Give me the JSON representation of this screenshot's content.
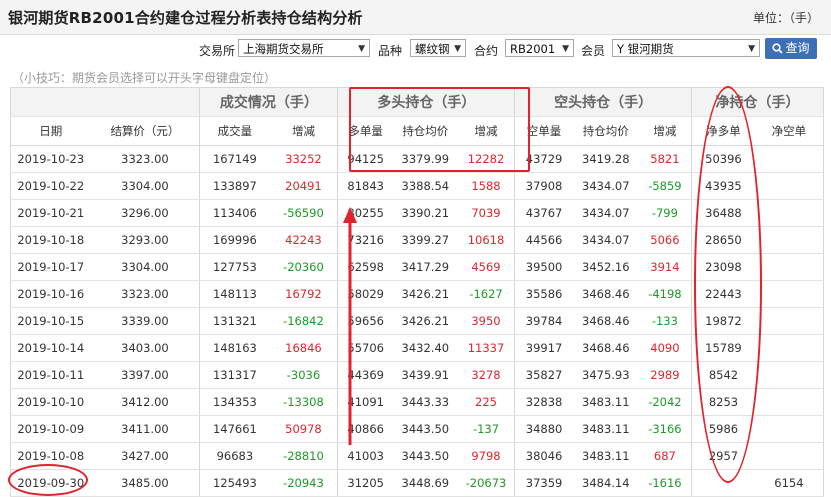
{
  "header": {
    "title": "银河期货RB2001合约建仓过程分析表持仓结构分析",
    "unit": "单位：（手）"
  },
  "filters": {
    "exchange_label": "交易所",
    "exchange_value": "上海期货交易所",
    "variety_label": "品种",
    "variety_value": "螺纹钢",
    "contract_label": "合约",
    "contract_value": "RB2001",
    "member_label": "会员",
    "member_value": "Y 银河期货",
    "search_label": "查询"
  },
  "tip": "（小技巧：期货会员选择可以开头字母键盘定位）",
  "table": {
    "group_headers": [
      "成交情况（手）",
      "多头持仓（手）",
      "空头持仓（手）",
      "净持仓（手）"
    ],
    "columns": [
      "日期",
      "结算价（元）",
      "成交量",
      "增减",
      "多单量",
      "持仓均价",
      "增减",
      "空单量",
      "持仓均价",
      "增减",
      "净多单",
      "净空单"
    ],
    "rows": [
      [
        "2019-10-23",
        "3323.00",
        "167149",
        "33252",
        "94125",
        "3379.99",
        "12282",
        "43729",
        "3419.28",
        "5821",
        "50396",
        ""
      ],
      [
        "2019-10-22",
        "3304.00",
        "133897",
        "20491",
        "81843",
        "3388.54",
        "1588",
        "37908",
        "3434.07",
        "-5859",
        "43935",
        ""
      ],
      [
        "2019-10-21",
        "3296.00",
        "113406",
        "-56590",
        "80255",
        "3390.21",
        "7039",
        "43767",
        "3434.07",
        "-799",
        "36488",
        ""
      ],
      [
        "2019-10-18",
        "3293.00",
        "169996",
        "42243",
        "73216",
        "3399.27",
        "10618",
        "44566",
        "3434.07",
        "5066",
        "28650",
        ""
      ],
      [
        "2019-10-17",
        "3304.00",
        "127753",
        "-20360",
        "62598",
        "3417.29",
        "4569",
        "39500",
        "3452.16",
        "3914",
        "23098",
        ""
      ],
      [
        "2019-10-16",
        "3323.00",
        "148113",
        "16792",
        "58029",
        "3426.21",
        "-1627",
        "35586",
        "3468.46",
        "-4198",
        "22443",
        ""
      ],
      [
        "2019-10-15",
        "3339.00",
        "131321",
        "-16842",
        "59656",
        "3426.21",
        "3950",
        "39784",
        "3468.46",
        "-133",
        "19872",
        ""
      ],
      [
        "2019-10-14",
        "3403.00",
        "148163",
        "16846",
        "55706",
        "3432.40",
        "11337",
        "39917",
        "3468.46",
        "4090",
        "15789",
        ""
      ],
      [
        "2019-10-11",
        "3397.00",
        "131317",
        "-3036",
        "44369",
        "3439.91",
        "3278",
        "35827",
        "3475.93",
        "2989",
        "8542",
        ""
      ],
      [
        "2019-10-10",
        "3412.00",
        "134353",
        "-13308",
        "41091",
        "3443.33",
        "225",
        "32838",
        "3483.11",
        "-2042",
        "8253",
        ""
      ],
      [
        "2019-10-09",
        "3411.00",
        "147661",
        "50978",
        "40866",
        "3443.50",
        "-137",
        "34880",
        "3483.11",
        "-3166",
        "5986",
        ""
      ],
      [
        "2019-10-08",
        "3427.00",
        "96683",
        "-28810",
        "41003",
        "3443.50",
        "9798",
        "38046",
        "3483.11",
        "687",
        "2957",
        ""
      ],
      [
        "2019-09-30",
        "3485.00",
        "125493",
        "-20943",
        "31205",
        "3448.69",
        "-20673",
        "37359",
        "3484.14",
        "-1616",
        "",
        "6154"
      ]
    ]
  },
  "colors": {
    "positive": "#e0252c",
    "negative": "#1c9b27",
    "annotation": "#e3232b",
    "button": "#3d6fb6"
  }
}
